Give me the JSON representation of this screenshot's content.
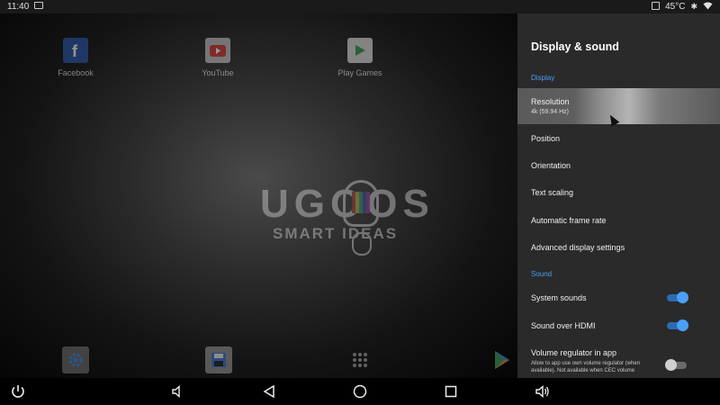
{
  "status_bar": {
    "time": "11:40",
    "temperature": "45°C",
    "icons": [
      "screenshot-icon",
      "cpu-icon",
      "bluetooth-icon",
      "wifi-icon"
    ]
  },
  "desktop": {
    "apps": [
      {
        "name": "facebook",
        "label": "Facebook",
        "icon": "facebook-icon"
      },
      {
        "name": "youtube",
        "label": "YouTube",
        "icon": "youtube-icon"
      },
      {
        "name": "play-games",
        "label": "Play Games",
        "icon": "play-games-icon"
      }
    ],
    "logo": {
      "line1": "UGOOS",
      "line2": "SMART IDEAS"
    },
    "dock": [
      "settings-icon",
      "save-icon",
      "app-drawer-icon",
      "play-store-icon"
    ]
  },
  "panel": {
    "title": "Display & sound",
    "display_header": "Display",
    "resolution_label": "Resolution",
    "resolution_value": "4k (59.94 Hz)",
    "position_label": "Position",
    "orientation_label": "Orientation",
    "text_scaling_label": "Text scaling",
    "auto_frame_rate_label": "Automatic frame rate",
    "advanced_display_label": "Advanced display settings",
    "sound_header": "Sound",
    "system_sounds_label": "System sounds",
    "system_sounds_on": true,
    "sound_hdmi_label": "Sound over HDMI",
    "sound_hdmi_on": true,
    "volume_regulator_label": "Volume regulator in app",
    "volume_regulator_desc": "Allow to app use own volume regulator (when available). Not available when CEC volume",
    "volume_regulator_on": false,
    "accent_color": "#4d9ef5"
  },
  "nav_bar": [
    "power-icon",
    "volume-down-icon",
    "back-icon",
    "home-icon",
    "recents-icon",
    "volume-up-icon"
  ]
}
